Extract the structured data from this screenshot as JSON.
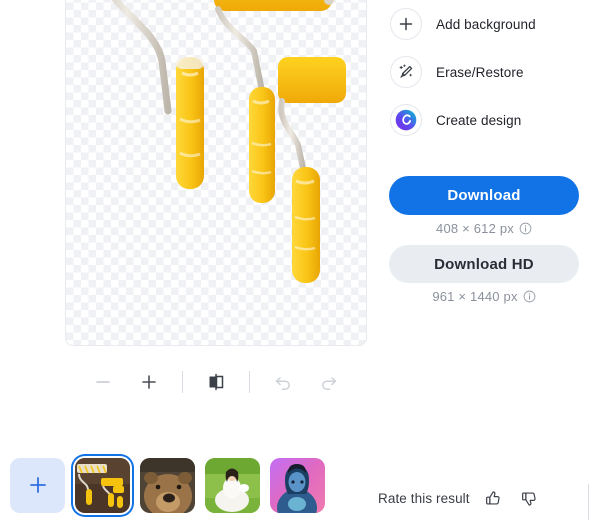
{
  "canvas": {
    "name": "image-canvas",
    "transparency_background": true,
    "subject": "three yellow paint rollers",
    "zoom_level_visible": false
  },
  "toolbar": {
    "zoom_out": {
      "label": "−",
      "icon": "minus-icon",
      "disabled": true
    },
    "zoom_in": {
      "label": "+",
      "icon": "plus-icon",
      "disabled": false
    },
    "compare": {
      "icon": "compare-split-icon",
      "disabled": false
    },
    "undo": {
      "icon": "undo-icon",
      "disabled": true
    },
    "redo": {
      "icon": "redo-icon",
      "disabled": true
    }
  },
  "actions": [
    {
      "label": "Add background",
      "icon": "plus-icon"
    },
    {
      "label": "Erase/Restore",
      "icon": "magic-brush-icon"
    },
    {
      "label": "Create design",
      "icon": "canva-logo-icon"
    }
  ],
  "download": {
    "primary_label": "Download",
    "primary_dimensions": "408 × 612 px",
    "hd_label": "Download HD",
    "hd_dimensions": "961 × 1440 px",
    "info_icon": "info-icon"
  },
  "thumbnails": {
    "add_label": "+",
    "items": [
      {
        "name": "paint-rollers",
        "selected": true
      },
      {
        "name": "bear",
        "selected": false
      },
      {
        "name": "girl-in-white-dress",
        "selected": false
      },
      {
        "name": "woman-neon-portrait",
        "selected": false
      }
    ]
  },
  "rate": {
    "label": "Rate this result",
    "thumbs_up_icon": "thumbs-up-icon",
    "thumbs_down_icon": "thumbs-down-icon"
  },
  "colors": {
    "accent_blue": "#1173E6",
    "hd_button_bg": "#E9EDF2",
    "muted_text": "#8B919C",
    "checker_light": "#EFF1F4",
    "add_tile_bg": "#DDE7FB"
  }
}
